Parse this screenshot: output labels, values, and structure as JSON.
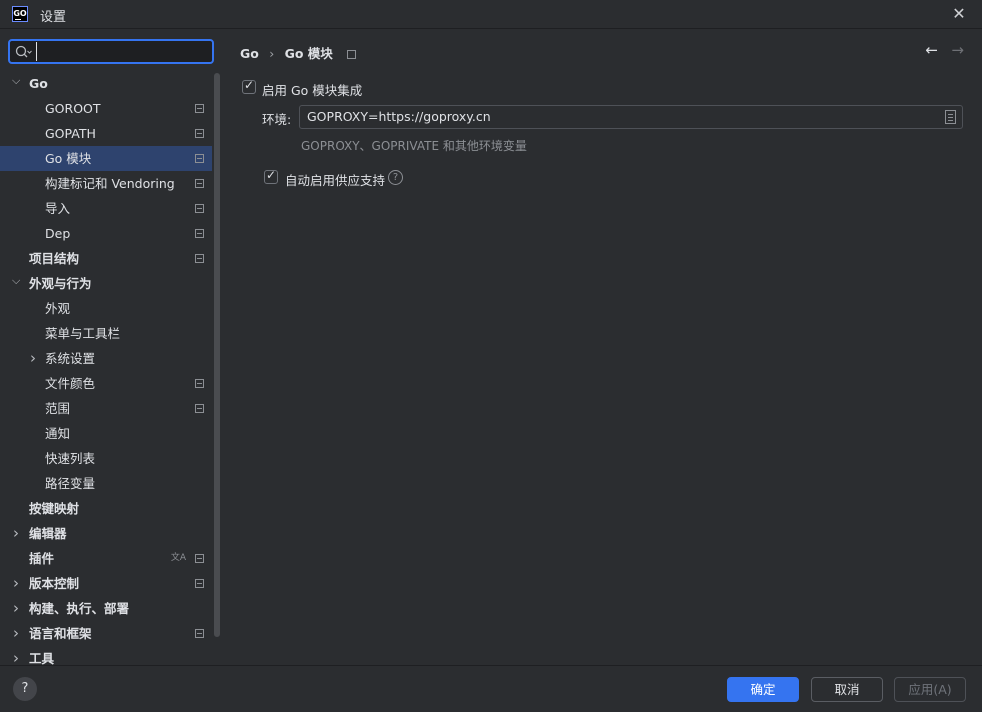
{
  "window": {
    "logo_text": "GO",
    "title": "设置"
  },
  "search": {
    "placeholder": "",
    "value": ""
  },
  "tree": [
    {
      "label": "Go",
      "level": 1,
      "chevron": "expanded",
      "pinned": false,
      "selected": false
    },
    {
      "label": "GOROOT",
      "level": 2,
      "chevron": "none",
      "pinned": true,
      "selected": false
    },
    {
      "label": "GOPATH",
      "level": 2,
      "chevron": "none",
      "pinned": true,
      "selected": false
    },
    {
      "label": "Go 模块",
      "level": 2,
      "chevron": "none",
      "pinned": true,
      "selected": true
    },
    {
      "label": "构建标记和 Vendoring",
      "level": 2,
      "chevron": "none",
      "pinned": true,
      "selected": false
    },
    {
      "label": "导入",
      "level": 2,
      "chevron": "none",
      "pinned": true,
      "selected": false
    },
    {
      "label": "Dep",
      "level": 2,
      "chevron": "none",
      "pinned": true,
      "selected": false
    },
    {
      "label": "项目结构",
      "level": 0,
      "chevron": "none",
      "pinned": true,
      "selected": false
    },
    {
      "label": "外观与行为",
      "level": 1,
      "chevron": "expanded",
      "pinned": false,
      "selected": false
    },
    {
      "label": "外观",
      "level": 2,
      "chevron": "none",
      "pinned": false,
      "selected": false
    },
    {
      "label": "菜单与工具栏",
      "level": 2,
      "chevron": "none",
      "pinned": false,
      "selected": false
    },
    {
      "label": "系统设置",
      "level": 2,
      "chevron": "collapsed",
      "pinned": false,
      "selected": false
    },
    {
      "label": "文件颜色",
      "level": 2,
      "chevron": "none",
      "pinned": true,
      "selected": false
    },
    {
      "label": "范围",
      "level": 2,
      "chevron": "none",
      "pinned": true,
      "selected": false
    },
    {
      "label": "通知",
      "level": 2,
      "chevron": "none",
      "pinned": false,
      "selected": false
    },
    {
      "label": "快速列表",
      "level": 2,
      "chevron": "none",
      "pinned": false,
      "selected": false
    },
    {
      "label": "路径变量",
      "level": 2,
      "chevron": "none",
      "pinned": false,
      "selected": false
    },
    {
      "label": "按键映射",
      "level": 0,
      "chevron": "none",
      "pinned": false,
      "selected": false
    },
    {
      "label": "编辑器",
      "level": 1,
      "chevron": "collapsed",
      "pinned": false,
      "selected": false
    },
    {
      "label": "插件",
      "level": 0,
      "chevron": "none",
      "pinned": true,
      "selected": false,
      "translate_icon": true
    },
    {
      "label": "版本控制",
      "level": 1,
      "chevron": "collapsed",
      "pinned": true,
      "selected": false
    },
    {
      "label": "构建、执行、部署",
      "level": 1,
      "chevron": "collapsed",
      "pinned": false,
      "selected": false
    },
    {
      "label": "语言和框架",
      "level": 1,
      "chevron": "collapsed",
      "pinned": true,
      "selected": false
    },
    {
      "label": "工具",
      "level": 1,
      "chevron": "collapsed",
      "pinned": false,
      "selected": false
    }
  ],
  "breadcrumb": {
    "parent": "Go",
    "separator": "›",
    "current": "Go 模块"
  },
  "nav": {
    "back": "←",
    "forward": "→"
  },
  "settings": {
    "enable_modules": {
      "label": "启用 Go 模块集成",
      "checked": true
    },
    "env_label": "环境:",
    "env_value": "GOPROXY=https://goproxy.cn",
    "env_hint": "GOPROXY、GOPRIVATE 和其他环境变量",
    "vendoring": {
      "label": "自动启用供应支持",
      "checked": true
    },
    "help_symbol": "?"
  },
  "footer": {
    "help": "?",
    "ok": "确定",
    "cancel": "取消",
    "apply": "应用(A)"
  },
  "colors": {
    "background": "#2b2d30",
    "selection": "#2e436e",
    "accent": "#3574f0"
  }
}
